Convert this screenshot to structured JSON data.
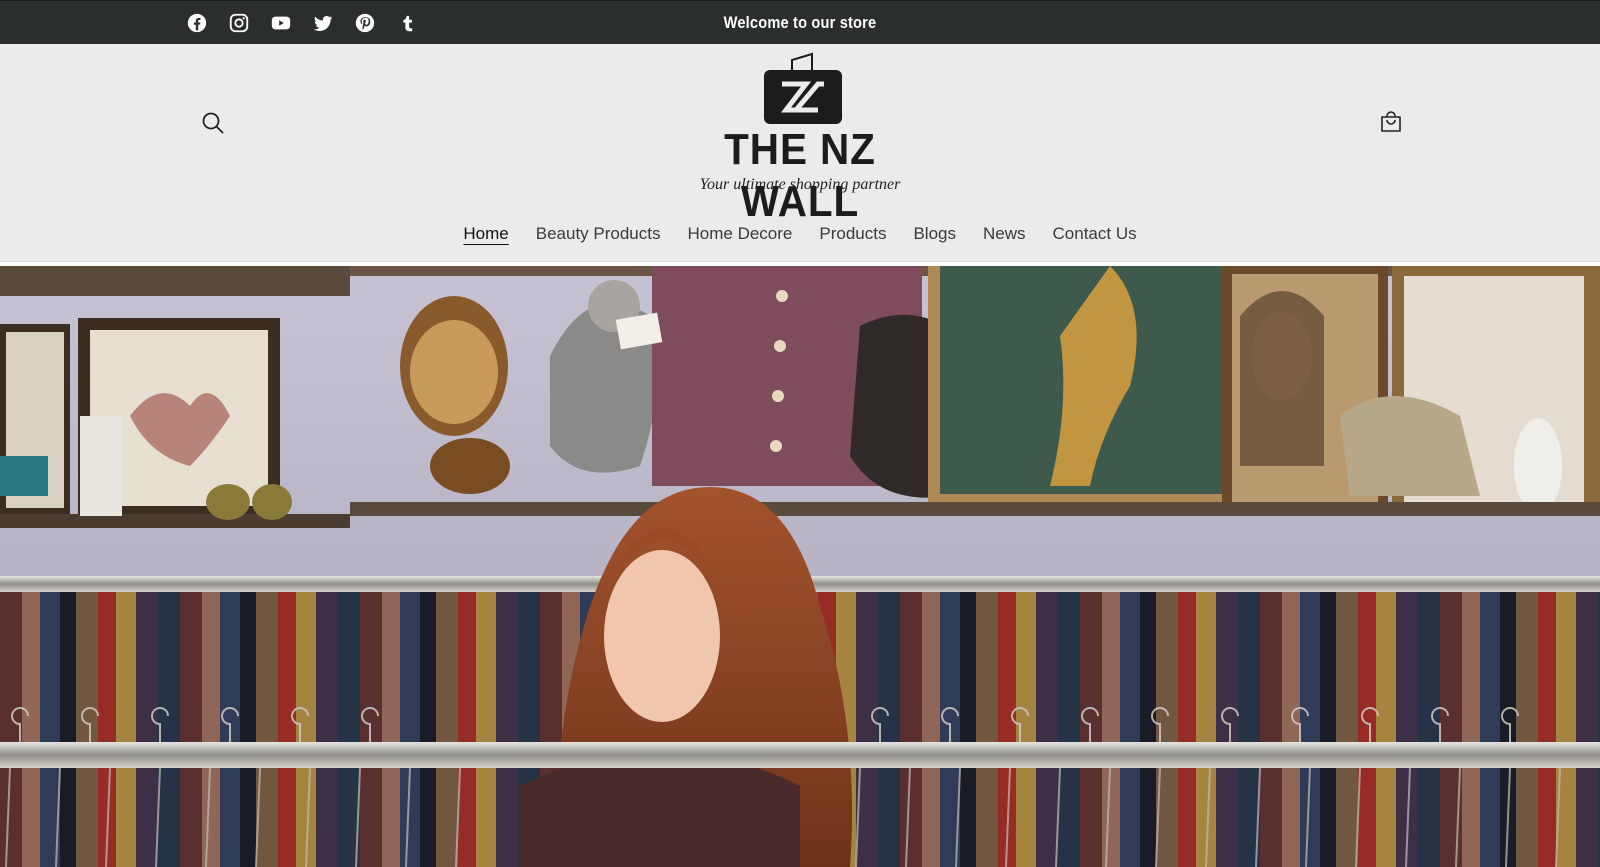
{
  "announcement": {
    "text": "Welcome to our store"
  },
  "social_icons": [
    "facebook-icon",
    "instagram-icon",
    "youtube-icon",
    "twitter-icon",
    "pinterest-icon",
    "tumblr-icon"
  ],
  "header": {
    "logo_name": "THE NZ WALL",
    "logo_mark_text": "NZ",
    "tagline": "Your ultimate shopping partner",
    "search_icon": "search-icon",
    "cart_icon": "cart-icon"
  },
  "nav": {
    "items": [
      {
        "label": "Home",
        "active": true
      },
      {
        "label": "Beauty Products",
        "active": false
      },
      {
        "label": "Home Decore",
        "active": false
      },
      {
        "label": "Products",
        "active": false
      },
      {
        "label": "Blogs",
        "active": false
      },
      {
        "label": "News",
        "active": false
      },
      {
        "label": "Contact Us",
        "active": false
      }
    ]
  },
  "colors": {
    "announcement_bg": "#2b2f2b",
    "header_bg": "#ecebec",
    "text_dark": "#1c1c1c"
  },
  "hero": {
    "image": "thrift-store-clothing-racks-photo"
  }
}
